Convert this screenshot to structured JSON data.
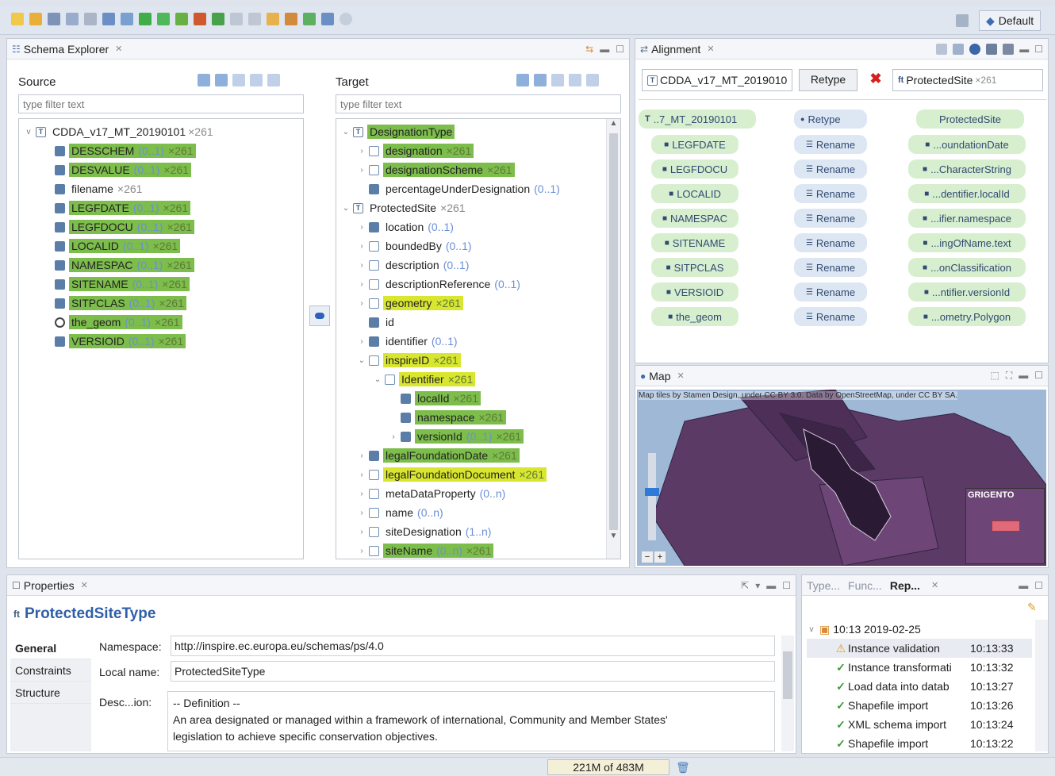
{
  "toolbar": {
    "perspective_label": "Default"
  },
  "schema_explorer": {
    "title": "Schema Explorer",
    "source": {
      "label": "Source",
      "filter_placeholder": "type filter text",
      "root": {
        "name": "CDDA_v17_MT_20190101",
        "count": "×261"
      },
      "items": [
        {
          "name": "DESSCHEM",
          "meta": "(0..1)",
          "count": "×261",
          "hl": "g",
          "icon": "a"
        },
        {
          "name": "DESVALUE",
          "meta": "(0..1)",
          "count": "×261",
          "hl": "g",
          "icon": "a"
        },
        {
          "name": "filename",
          "meta": "",
          "count": "×261",
          "hl": "",
          "icon": "a"
        },
        {
          "name": "LEGFDATE",
          "meta": "(0..1)",
          "count": "×261",
          "hl": "g",
          "icon": "a"
        },
        {
          "name": "LEGFDOCU",
          "meta": "(0..1)",
          "count": "×261",
          "hl": "g",
          "icon": "a"
        },
        {
          "name": "LOCALID",
          "meta": "(0..1)",
          "count": "×261",
          "hl": "g",
          "icon": "a"
        },
        {
          "name": "NAMESPAC",
          "meta": "(0..1)",
          "count": "×261",
          "hl": "g",
          "icon": "a"
        },
        {
          "name": "SITENAME",
          "meta": "(0..1)",
          "count": "×261",
          "hl": "g",
          "icon": "a"
        },
        {
          "name": "SITPCLAS",
          "meta": "(0..1)",
          "count": "×261",
          "hl": "g",
          "icon": "a"
        },
        {
          "name": "the_geom",
          "meta": "(0..1)",
          "count": "×261",
          "hl": "g",
          "icon": "g"
        },
        {
          "name": "VERSIOID",
          "meta": "(0..1)",
          "count": "×261",
          "hl": "g",
          "icon": "a"
        }
      ]
    },
    "target": {
      "label": "Target",
      "filter_placeholder": "type filter text",
      "items": [
        {
          "indent": 0,
          "tw": "v",
          "icon": "t",
          "name": "DesignationType",
          "meta": "",
          "count": "",
          "hl": "g"
        },
        {
          "indent": 1,
          "tw": ">",
          "icon": "c",
          "name": "designation",
          "meta": "",
          "count": "×261",
          "hl": "g"
        },
        {
          "indent": 1,
          "tw": ">",
          "icon": "c",
          "name": "designationScheme",
          "meta": "",
          "count": "×261",
          "hl": "g"
        },
        {
          "indent": 1,
          "tw": "",
          "icon": "a",
          "name": "percentageUnderDesignation",
          "meta": "(0..1)",
          "count": "",
          "hl": ""
        },
        {
          "indent": 0,
          "tw": "v",
          "icon": "t",
          "name": "ProtectedSite",
          "meta": "",
          "count": "×261",
          "hl": ""
        },
        {
          "indent": 1,
          "tw": ">",
          "icon": "a",
          "name": "location",
          "meta": "(0..1)",
          "count": "",
          "hl": ""
        },
        {
          "indent": 1,
          "tw": ">",
          "icon": "c",
          "name": "boundedBy",
          "meta": "(0..1)",
          "count": "",
          "hl": ""
        },
        {
          "indent": 1,
          "tw": ">",
          "icon": "c",
          "name": "description",
          "meta": "(0..1)",
          "count": "",
          "hl": ""
        },
        {
          "indent": 1,
          "tw": ">",
          "icon": "c",
          "name": "descriptionReference",
          "meta": "(0..1)",
          "count": "",
          "hl": ""
        },
        {
          "indent": 1,
          "tw": ">",
          "icon": "c",
          "name": "geometry",
          "meta": "",
          "count": "×261",
          "hl": "y"
        },
        {
          "indent": 1,
          "tw": "",
          "icon": "a",
          "name": "id",
          "meta": "",
          "count": "",
          "hl": ""
        },
        {
          "indent": 1,
          "tw": ">",
          "icon": "a",
          "name": "identifier",
          "meta": "(0..1)",
          "count": "",
          "hl": ""
        },
        {
          "indent": 1,
          "tw": "v",
          "icon": "c",
          "name": "inspireID",
          "meta": "",
          "count": "×261",
          "hl": "y"
        },
        {
          "indent": 2,
          "tw": "v",
          "icon": "c",
          "name": "Identifier",
          "meta": "",
          "count": "×261",
          "hl": "y"
        },
        {
          "indent": 3,
          "tw": "",
          "icon": "a",
          "name": "localId",
          "meta": "",
          "count": "×261",
          "hl": "g"
        },
        {
          "indent": 3,
          "tw": "",
          "icon": "a",
          "name": "namespace",
          "meta": "",
          "count": "×261",
          "hl": "g"
        },
        {
          "indent": 3,
          "tw": ">",
          "icon": "a",
          "name": "versionId",
          "meta": "(0..1)",
          "count": "×261",
          "hl": "g"
        },
        {
          "indent": 1,
          "tw": ">",
          "icon": "a",
          "name": "legalFoundationDate",
          "meta": "",
          "count": "×261",
          "hl": "g"
        },
        {
          "indent": 1,
          "tw": ">",
          "icon": "c",
          "name": "legalFoundationDocument",
          "meta": "",
          "count": "×261",
          "hl": "y"
        },
        {
          "indent": 1,
          "tw": ">",
          "icon": "c",
          "name": "metaDataProperty",
          "meta": "(0..n)",
          "count": "",
          "hl": ""
        },
        {
          "indent": 1,
          "tw": ">",
          "icon": "c",
          "name": "name",
          "meta": "(0..n)",
          "count": "",
          "hl": ""
        },
        {
          "indent": 1,
          "tw": ">",
          "icon": "c",
          "name": "siteDesignation",
          "meta": "(1..n)",
          "count": "",
          "hl": ""
        },
        {
          "indent": 1,
          "tw": ">",
          "icon": "c",
          "name": "siteName",
          "meta": "(0..n)",
          "count": "×261",
          "hl": "g"
        }
      ]
    }
  },
  "alignment": {
    "title": "Alignment",
    "source_type": "CDDA_v17_MT_2019010",
    "retype_button": "Retype",
    "target_type": "ProtectedSite",
    "target_count": "×261",
    "head": {
      "source": "..7_MT_20190101",
      "fn": "Retype",
      "target": "ProtectedSite"
    },
    "rows": [
      {
        "source": "LEGFDATE",
        "fn": "Rename",
        "target": "...oundationDate"
      },
      {
        "source": "LEGFDOCU",
        "fn": "Rename",
        "target": "...CharacterString"
      },
      {
        "source": "LOCALID",
        "fn": "Rename",
        "target": "...dentifier.localId"
      },
      {
        "source": "NAMESPAC",
        "fn": "Rename",
        "target": "...ifier.namespace"
      },
      {
        "source": "SITENAME",
        "fn": "Rename",
        "target": "...ingOfName.text"
      },
      {
        "source": "SITPCLAS",
        "fn": "Rename",
        "target": "...onClassification"
      },
      {
        "source": "VERSIOID",
        "fn": "Rename",
        "target": "...ntifier.versionId"
      },
      {
        "source": "the_geom",
        "fn": "Rename",
        "target": "...ometry.Polygon"
      }
    ]
  },
  "map": {
    "title": "Map",
    "attribution": "Map tiles by Stamen Design, under CC BY 3.0. Data by OpenStreetMap, under CC BY SA.",
    "place_label": "GRIGENTO",
    "zoom_minus": "−",
    "zoom_plus": "+"
  },
  "properties": {
    "title": "Properties",
    "type_title": "ProtectedSiteType",
    "tabs": [
      "General",
      "Constraints",
      "Structure"
    ],
    "namespace_label": "Namespace:",
    "namespace_value": "http://inspire.ec.europa.eu/schemas/ps/4.0",
    "localname_label": "Local name:",
    "localname_value": "ProtectedSiteType",
    "desc_label": "Desc...ion:",
    "desc_lines": [
      "-- Definition --",
      "An area designated or managed within a framework of international, Community and Member States'",
      "legislation to achieve specific conservation objectives."
    ]
  },
  "reports": {
    "tabs": [
      "Type...",
      "Func...",
      "Rep..."
    ],
    "group": "10:13 2019-02-25",
    "rows": [
      {
        "icon": "warn",
        "label": "Instance validation",
        "time": "10:13:33"
      },
      {
        "icon": "ok",
        "label": "Instance transformati",
        "time": "10:13:32"
      },
      {
        "icon": "ok",
        "label": "Load data into datab",
        "time": "10:13:27"
      },
      {
        "icon": "ok",
        "label": "Shapefile import",
        "time": "10:13:26"
      },
      {
        "icon": "ok",
        "label": "XML schema import",
        "time": "10:13:24"
      },
      {
        "icon": "ok",
        "label": "Shapefile import",
        "time": "10:13:22"
      }
    ]
  },
  "status": {
    "memory": "221M of 483M"
  }
}
